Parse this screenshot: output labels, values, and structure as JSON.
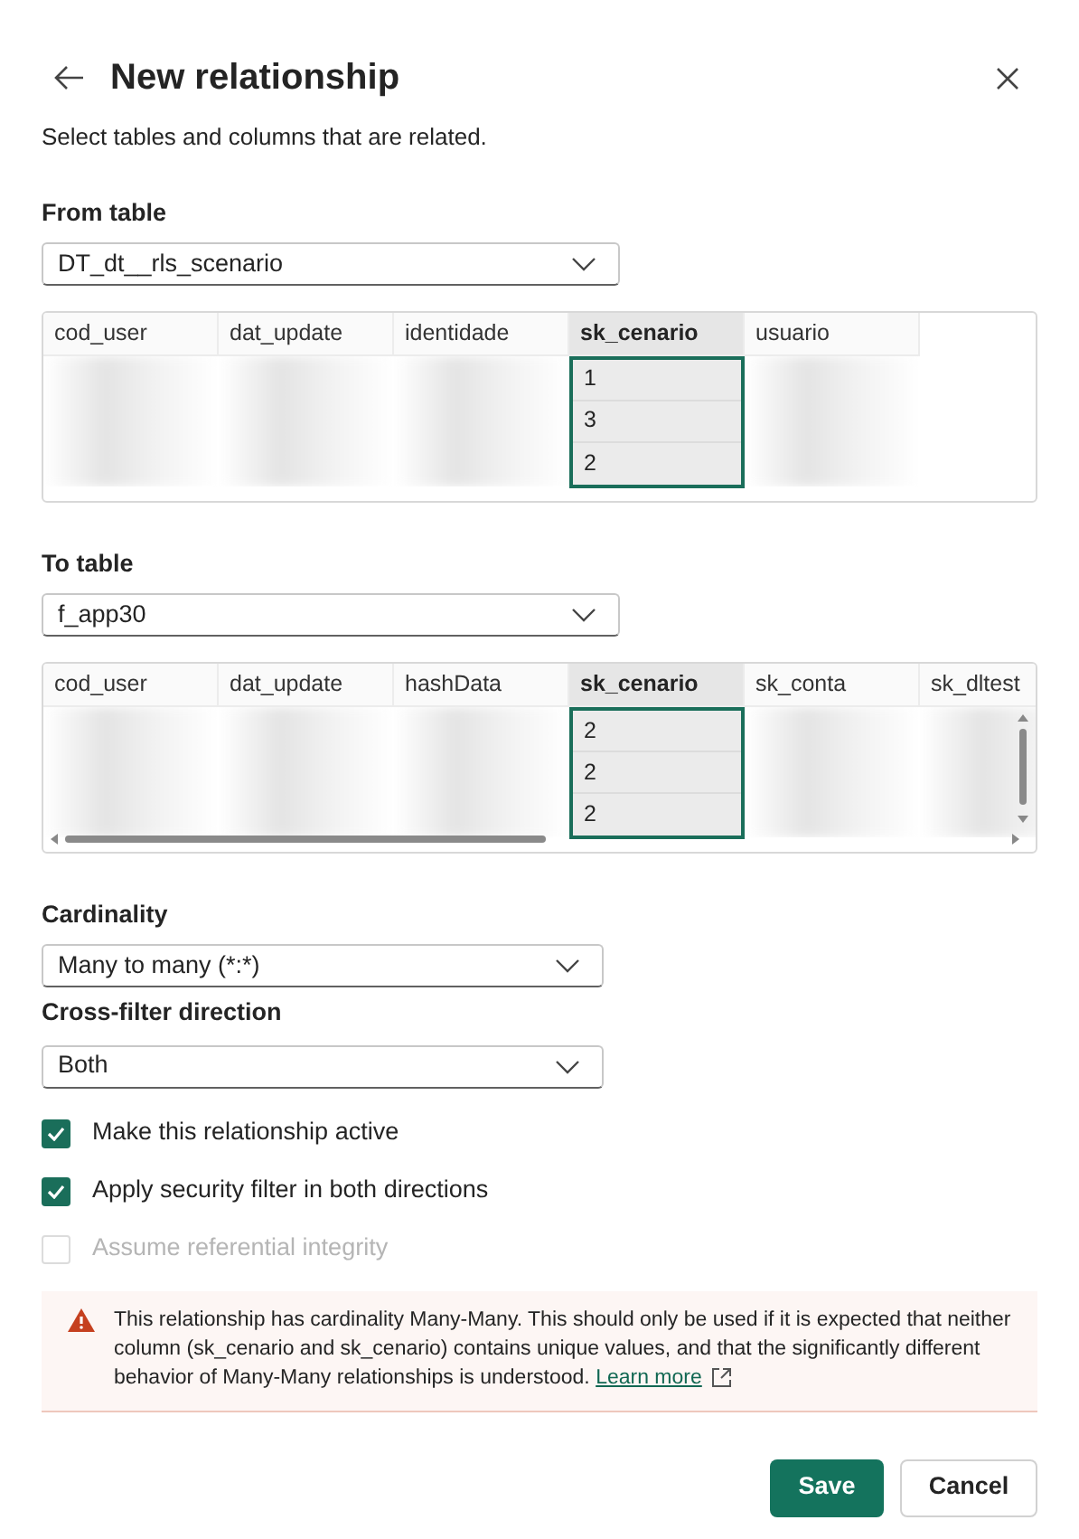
{
  "dialog": {
    "title": "New relationship",
    "subtitle": "Select tables and columns that are related."
  },
  "tables": [
    {
      "label": "From table",
      "value": "DT_dt__rls_scenario",
      "scroll": false,
      "columns": [
        {
          "name": "cod_user",
          "selected": false
        },
        {
          "name": "dat_update",
          "selected": false
        },
        {
          "name": "identidade",
          "selected": false
        },
        {
          "name": "sk_cenario",
          "selected": true,
          "values": [
            "1",
            "3",
            "2"
          ]
        },
        {
          "name": "usuario",
          "selected": false
        }
      ]
    },
    {
      "label": "To table",
      "value": "f_app30",
      "scroll": true,
      "columns": [
        {
          "name": "cod_user",
          "selected": false
        },
        {
          "name": "dat_update",
          "selected": false
        },
        {
          "name": "hashData",
          "selected": false
        },
        {
          "name": "sk_cenario",
          "selected": true,
          "values": [
            "2",
            "2",
            "2"
          ]
        },
        {
          "name": "sk_conta",
          "selected": false
        },
        {
          "name": "sk_dltest",
          "selected": false
        }
      ]
    }
  ],
  "cardinality": {
    "label": "Cardinality",
    "value": "Many to many (*:*)"
  },
  "cross_filter": {
    "label": "Cross-filter direction",
    "value": "Both"
  },
  "options": [
    {
      "label": "Make this relationship active",
      "checked": true,
      "disabled": false
    },
    {
      "label": "Apply security filter in both directions",
      "checked": true,
      "disabled": false
    },
    {
      "label": "Assume referential integrity",
      "checked": false,
      "disabled": true
    }
  ],
  "warning": {
    "text": "This relationship has cardinality Many-Many. This should only be used if it is expected that neither column (sk_cenario and sk_cenario) contains unique values, and that the significantly different behavior of Many-Many relationships is understood.",
    "link": "Learn more"
  },
  "buttons": [
    {
      "label": "Save",
      "kind": "primary"
    },
    {
      "label": "Cancel",
      "kind": "secondary"
    }
  ]
}
